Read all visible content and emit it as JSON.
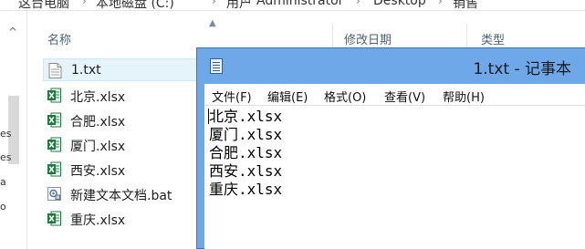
{
  "explorer": {
    "breadcrumb": [
      "这台电脑",
      "本地磁盘 (C:)",
      "用户",
      "Administrator",
      "Desktop",
      "销售"
    ],
    "columns": {
      "name": "名称",
      "modified": "修改日期",
      "type": "类型"
    },
    "files": [
      {
        "name": "1.txt",
        "icon": "text-file-icon"
      },
      {
        "name": "北京.xlsx",
        "icon": "excel-file-icon"
      },
      {
        "name": "合肥.xlsx",
        "icon": "excel-file-icon"
      },
      {
        "name": "厦门.xlsx",
        "icon": "excel-file-icon"
      },
      {
        "name": "西安.xlsx",
        "icon": "excel-file-icon"
      },
      {
        "name": "新建文本文档.bat",
        "icon": "batch-file-icon"
      },
      {
        "name": "重庆.xlsx",
        "icon": "excel-file-icon"
      }
    ],
    "nav_fragments": [
      "es",
      "es",
      "a",
      "o"
    ]
  },
  "notepad": {
    "title": "1.txt - 记事本",
    "menu": [
      "文件(F)",
      "编辑(E)",
      "格式(O)",
      "查看(V)",
      "帮助(H)"
    ],
    "lines": [
      "北京.xlsx",
      "厦门.xlsx",
      "合肥.xlsx",
      "西安.xlsx",
      "重庆.xlsx"
    ]
  },
  "colors": {
    "notepad_frame": "#6fa8e8",
    "excel_green": "#1f7a3e",
    "selection": "#e5f3fb"
  }
}
